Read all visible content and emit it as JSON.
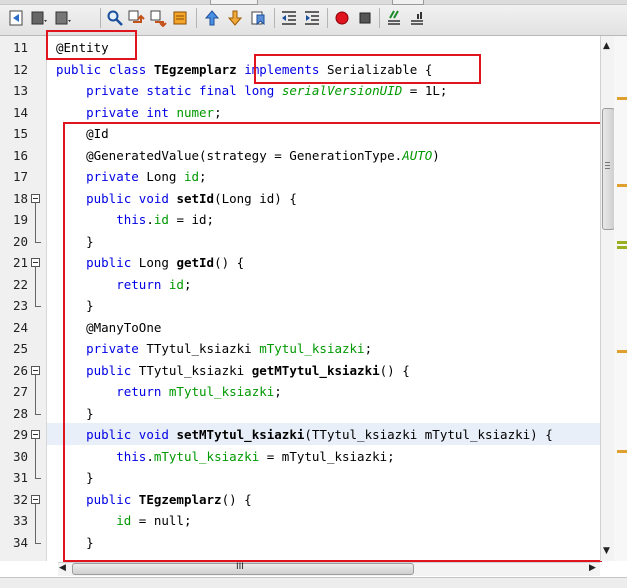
{
  "toolbar": {
    "buttons": [
      {
        "name": "back-source-icon"
      },
      {
        "name": "last-edit-icon"
      },
      {
        "name": "forward-icon"
      },
      {
        "name": "find-icon"
      },
      {
        "name": "find-previous-icon"
      },
      {
        "name": "find-next-icon"
      },
      {
        "name": "toggle-highlight-icon"
      },
      {
        "name": "previous-bookmark-icon"
      },
      {
        "name": "next-bookmark-icon"
      },
      {
        "name": "toggle-bookmark-icon"
      },
      {
        "name": "shift-left-icon"
      },
      {
        "name": "shift-right-icon"
      },
      {
        "name": "start-macro-icon"
      },
      {
        "name": "stop-macro-icon"
      },
      {
        "name": "comment-icon"
      },
      {
        "name": "uncomment-icon"
      }
    ],
    "colors": {
      "record": "#e0141e",
      "stop": "#555555"
    }
  },
  "editor": {
    "line_numbers": [
      "11",
      "12",
      "13",
      "14",
      "15",
      "16",
      "17",
      "18",
      "19",
      "20",
      "21",
      "22",
      "23",
      "24",
      "25",
      "26",
      "27",
      "28",
      "29",
      "30",
      "31",
      "32",
      "33",
      "34"
    ],
    "lines": [
      {
        "t": "@Entity"
      },
      {
        "t": "public class TEgzemplarz implements Serializable {"
      },
      {
        "t": "    private static final long serialVersionUID = 1L;"
      },
      {
        "t": "    private int numer;"
      },
      {
        "t": "    @Id"
      },
      {
        "t": "    @GeneratedValue(strategy = GenerationType.AUTO)"
      },
      {
        "t": "    private Long id;"
      },
      {
        "t": "    public void setId(Long id) {"
      },
      {
        "t": "        this.id = id;"
      },
      {
        "t": "    }"
      },
      {
        "t": "    public Long getId() {"
      },
      {
        "t": "        return id;"
      },
      {
        "t": "    }"
      },
      {
        "t": "    @ManyToOne"
      },
      {
        "t": "    private TTytul_ksiazki mTytul_ksiazki;"
      },
      {
        "t": "    public TTytul_ksiazki getMTytul_ksiazki() {"
      },
      {
        "t": "        return mTytul_ksiazki;"
      },
      {
        "t": "    }"
      },
      {
        "t": "    public void setMTytul_ksiazki(TTytul_ksiazki mTytul_ksiazki) {"
      },
      {
        "t": "        this.mTytul_ksiazki = mTytul_ksiazki;"
      },
      {
        "t": "    }"
      },
      {
        "t": "    public TEgzemplarz() {"
      },
      {
        "t": "        id = null;"
      },
      {
        "t": "    }"
      }
    ],
    "tokens": {
      "at_entity": "@Entity",
      "kw_public": "public",
      "kw_class": "class",
      "kw_implements": "implements",
      "kw_private": "private",
      "kw_static": "static",
      "kw_final": "final",
      "kw_long": "long",
      "kw_int": "int",
      "kw_void": "void",
      "kw_this": "this",
      "kw_return": "return",
      "class_name": "TEgzemplarz",
      "iface": "Serializable",
      "brace_open": "{",
      "brace_close": "}",
      "suid": "serialVersionUID",
      "suid_val": " = 1L;",
      "numer": "numer",
      "at_id": "@Id",
      "gen_pre": "@GeneratedValue(strategy = GenerationType.",
      "gen_auto": "AUTO",
      "gen_post": ")",
      "long_type": "Long",
      "id": "id",
      "semi": ";",
      "setId": "setId",
      "setId_args": "(Long id) {",
      "dot": ".",
      "assign_id": " = id;",
      "getId": "getId",
      "empty_args": "() {",
      "at_many": "@ManyToOne",
      "tt_type": "TTytul_ksiazki",
      "mt": "mTytul_ksiazki",
      "getM": "getMTytul_ksiazki",
      "setM": "setMTytul_ksiazki",
      "setM_args": "(TTytul_ksiazki mTytul_ksiazki) {",
      "assign_mt": " = mTytul_ksiazki;",
      "ctor": "TEgzemplarz",
      "assign_null": " = null;"
    },
    "highlighted_line": "29",
    "colors": {
      "keyword": "#0000e6",
      "field": "#009900",
      "annotation_box": "#e0141e",
      "current_line": "#e9eff8"
    }
  },
  "scrollbars": {
    "vertical_position": 0.15,
    "horizontal_position": 0.03,
    "h_thumb_grip": "III",
    "v_thumb_grip": "≡"
  },
  "markers": [
    {
      "color": "#e0a030"
    },
    {
      "color": "#e0a030"
    },
    {
      "color": "#9ab020"
    },
    {
      "color": "#9ab020"
    },
    {
      "color": "#e0a030"
    },
    {
      "color": "#e0a030"
    }
  ]
}
